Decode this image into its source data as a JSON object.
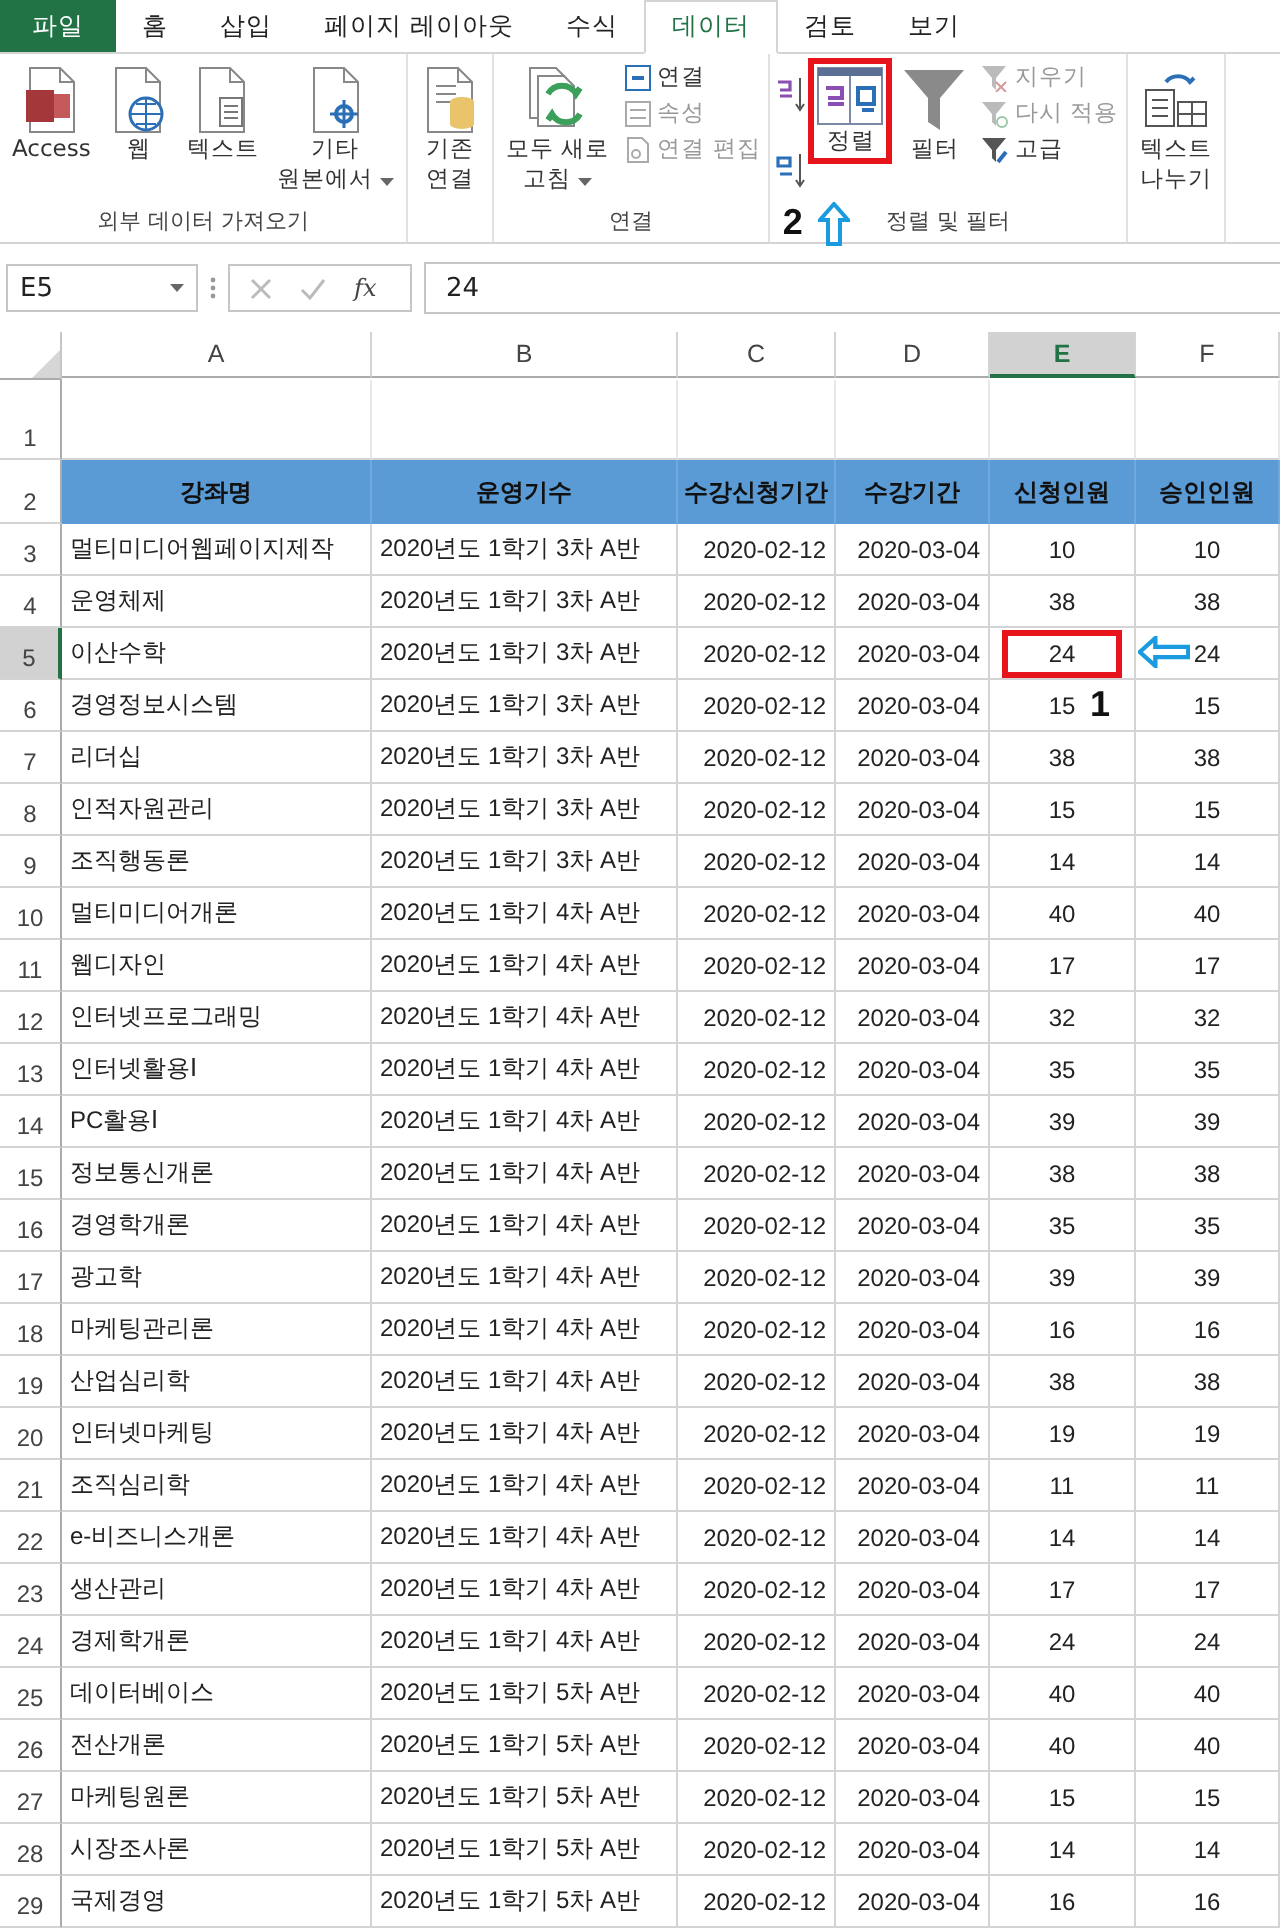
{
  "tabs": [
    {
      "label": "파일",
      "kind": "file",
      "selected": false
    },
    {
      "label": "홈",
      "kind": "tab",
      "selected": false
    },
    {
      "label": "삽입",
      "kind": "tab",
      "selected": false
    },
    {
      "label": "페이지 레이아웃",
      "kind": "tab",
      "selected": false
    },
    {
      "label": "수식",
      "kind": "tab",
      "selected": false
    },
    {
      "label": "데이터",
      "kind": "tab",
      "selected": true
    },
    {
      "label": "검토",
      "kind": "tab",
      "selected": false
    },
    {
      "label": "보기",
      "kind": "tab",
      "selected": false
    }
  ],
  "ribbon": {
    "groups": [
      {
        "label": "외부 데이터 가져오기",
        "columns": [
          {
            "kind": "large",
            "lines": [
              "Access"
            ],
            "dropdown": false
          },
          {
            "kind": "large",
            "lines": [
              "웹"
            ],
            "dropdown": false
          },
          {
            "kind": "large",
            "lines": [
              "텍스트"
            ],
            "dropdown": false
          },
          {
            "kind": "large",
            "lines": [
              "기타",
              "원본에서"
            ],
            "dropdown": true
          }
        ]
      },
      {
        "columns": [
          {
            "kind": "large",
            "lines": [
              "기존",
              "연결"
            ],
            "dropdown": false
          }
        ]
      },
      {
        "label": "연결",
        "columns": [
          {
            "kind": "large",
            "lines": [
              "모두 새로",
              "고침"
            ],
            "dropdown": true
          },
          {
            "kind": "stack",
            "items": [
              {
                "label": "연결",
                "disabled": false
              },
              {
                "label": "속성",
                "disabled": true
              },
              {
                "label": "연결 편집",
                "disabled": true
              }
            ]
          }
        ]
      },
      {
        "label": "정렬 및 필터",
        "columns": [
          {
            "kind": "sortpair"
          },
          {
            "kind": "large",
            "lines": [
              "정렬"
            ],
            "dropdown": false,
            "highlighted": true
          },
          {
            "kind": "large",
            "lines": [
              "필터"
            ],
            "dropdown": false
          },
          {
            "kind": "stack",
            "items": [
              {
                "label": "지우기",
                "disabled": true
              },
              {
                "label": "다시 적용",
                "disabled": true
              },
              {
                "label": "고급",
                "disabled": false
              }
            ]
          }
        ]
      },
      {
        "columns": [
          {
            "kind": "large",
            "lines": [
              "텍스트",
              "나누기"
            ],
            "dropdown": false
          }
        ]
      }
    ]
  },
  "formula_bar": {
    "name_box": "E5",
    "function_label": "fx",
    "value": "24"
  },
  "columns": [
    {
      "label": "A",
      "selected": false
    },
    {
      "label": "B",
      "selected": false
    },
    {
      "label": "C",
      "selected": false
    },
    {
      "label": "D",
      "selected": false
    },
    {
      "label": "E",
      "selected": true
    },
    {
      "label": "F",
      "selected": false
    }
  ],
  "blank_row": {
    "number": "1"
  },
  "header_row": {
    "number": "2",
    "cells": [
      "강좌명",
      "운영기수",
      "수강신청기간",
      "수강기간",
      "신청인원",
      "승인인원"
    ]
  },
  "rows": [
    {
      "number": "3",
      "selected": false,
      "cells": [
        "멀티미디어웹페이지제작",
        "2020년도 1학기 3차 A반",
        "2020-02-12",
        "2020-03-04",
        "10",
        "10"
      ]
    },
    {
      "number": "4",
      "selected": false,
      "cells": [
        "운영체제",
        "2020년도 1학기 3차 A반",
        "2020-02-12",
        "2020-03-04",
        "38",
        "38"
      ]
    },
    {
      "number": "5",
      "selected": true,
      "cells": [
        "이산수학",
        "2020년도 1학기 3차 A반",
        "2020-02-12",
        "2020-03-04",
        "24",
        "24"
      ]
    },
    {
      "number": "6",
      "selected": false,
      "cells": [
        "경영정보시스템",
        "2020년도 1학기 3차 A반",
        "2020-02-12",
        "2020-03-04",
        "15",
        "15"
      ]
    },
    {
      "number": "7",
      "selected": false,
      "cells": [
        "리더십",
        "2020년도 1학기 3차 A반",
        "2020-02-12",
        "2020-03-04",
        "38",
        "38"
      ]
    },
    {
      "number": "8",
      "selected": false,
      "cells": [
        "인적자원관리",
        "2020년도 1학기 3차 A반",
        "2020-02-12",
        "2020-03-04",
        "15",
        "15"
      ]
    },
    {
      "number": "9",
      "selected": false,
      "cells": [
        "조직행동론",
        "2020년도 1학기 3차 A반",
        "2020-02-12",
        "2020-03-04",
        "14",
        "14"
      ]
    },
    {
      "number": "10",
      "selected": false,
      "cells": [
        "멀티미디어개론",
        "2020년도 1학기 4차 A반",
        "2020-02-12",
        "2020-03-04",
        "40",
        "40"
      ]
    },
    {
      "number": "11",
      "selected": false,
      "cells": [
        "웹디자인",
        "2020년도 1학기 4차 A반",
        "2020-02-12",
        "2020-03-04",
        "17",
        "17"
      ]
    },
    {
      "number": "12",
      "selected": false,
      "cells": [
        "인터넷프로그래밍",
        "2020년도 1학기 4차 A반",
        "2020-02-12",
        "2020-03-04",
        "32",
        "32"
      ]
    },
    {
      "number": "13",
      "selected": false,
      "cells": [
        "인터넷활용Ⅰ",
        "2020년도 1학기 4차 A반",
        "2020-02-12",
        "2020-03-04",
        "35",
        "35"
      ]
    },
    {
      "number": "14",
      "selected": false,
      "cells": [
        "PC활용Ⅰ",
        "2020년도 1학기 4차 A반",
        "2020-02-12",
        "2020-03-04",
        "39",
        "39"
      ]
    },
    {
      "number": "15",
      "selected": false,
      "cells": [
        "정보통신개론",
        "2020년도 1학기 4차 A반",
        "2020-02-12",
        "2020-03-04",
        "38",
        "38"
      ]
    },
    {
      "number": "16",
      "selected": false,
      "cells": [
        "경영학개론",
        "2020년도 1학기 4차 A반",
        "2020-02-12",
        "2020-03-04",
        "35",
        "35"
      ]
    },
    {
      "number": "17",
      "selected": false,
      "cells": [
        "광고학",
        "2020년도 1학기 4차 A반",
        "2020-02-12",
        "2020-03-04",
        "39",
        "39"
      ]
    },
    {
      "number": "18",
      "selected": false,
      "cells": [
        "마케팅관리론",
        "2020년도 1학기 4차 A반",
        "2020-02-12",
        "2020-03-04",
        "16",
        "16"
      ]
    },
    {
      "number": "19",
      "selected": false,
      "cells": [
        "산업심리학",
        "2020년도 1학기 4차 A반",
        "2020-02-12",
        "2020-03-04",
        "38",
        "38"
      ]
    },
    {
      "number": "20",
      "selected": false,
      "cells": [
        "인터넷마케팅",
        "2020년도 1학기 4차 A반",
        "2020-02-12",
        "2020-03-04",
        "19",
        "19"
      ]
    },
    {
      "number": "21",
      "selected": false,
      "cells": [
        "조직심리학",
        "2020년도 1학기 4차 A반",
        "2020-02-12",
        "2020-03-04",
        "11",
        "11"
      ]
    },
    {
      "number": "22",
      "selected": false,
      "cells": [
        "e-비즈니스개론",
        "2020년도 1학기 4차 A반",
        "2020-02-12",
        "2020-03-04",
        "14",
        "14"
      ]
    },
    {
      "number": "23",
      "selected": false,
      "cells": [
        "생산관리",
        "2020년도 1학기 4차 A반",
        "2020-02-12",
        "2020-03-04",
        "17",
        "17"
      ]
    },
    {
      "number": "24",
      "selected": false,
      "cells": [
        "경제학개론",
        "2020년도 1학기 4차 A반",
        "2020-02-12",
        "2020-03-04",
        "24",
        "24"
      ]
    },
    {
      "number": "25",
      "selected": false,
      "cells": [
        "데이터베이스",
        "2020년도 1학기 5차 A반",
        "2020-02-12",
        "2020-03-04",
        "40",
        "40"
      ]
    },
    {
      "number": "26",
      "selected": false,
      "cells": [
        "전산개론",
        "2020년도 1학기 5차 A반",
        "2020-02-12",
        "2020-03-04",
        "40",
        "40"
      ]
    },
    {
      "number": "27",
      "selected": false,
      "cells": [
        "마케팅원론",
        "2020년도 1학기 5차 A반",
        "2020-02-12",
        "2020-03-04",
        "15",
        "15"
      ]
    },
    {
      "number": "28",
      "selected": false,
      "cells": [
        "시장조사론",
        "2020년도 1학기 5차 A반",
        "2020-02-12",
        "2020-03-04",
        "14",
        "14"
      ]
    },
    {
      "number": "29",
      "selected": false,
      "cells": [
        "국제경영",
        "2020년도 1학기 5차 A반",
        "2020-02-12",
        "2020-03-04",
        "16",
        "16"
      ]
    }
  ],
  "annotations": [
    {
      "step": "1"
    },
    {
      "step": "2"
    }
  ]
}
